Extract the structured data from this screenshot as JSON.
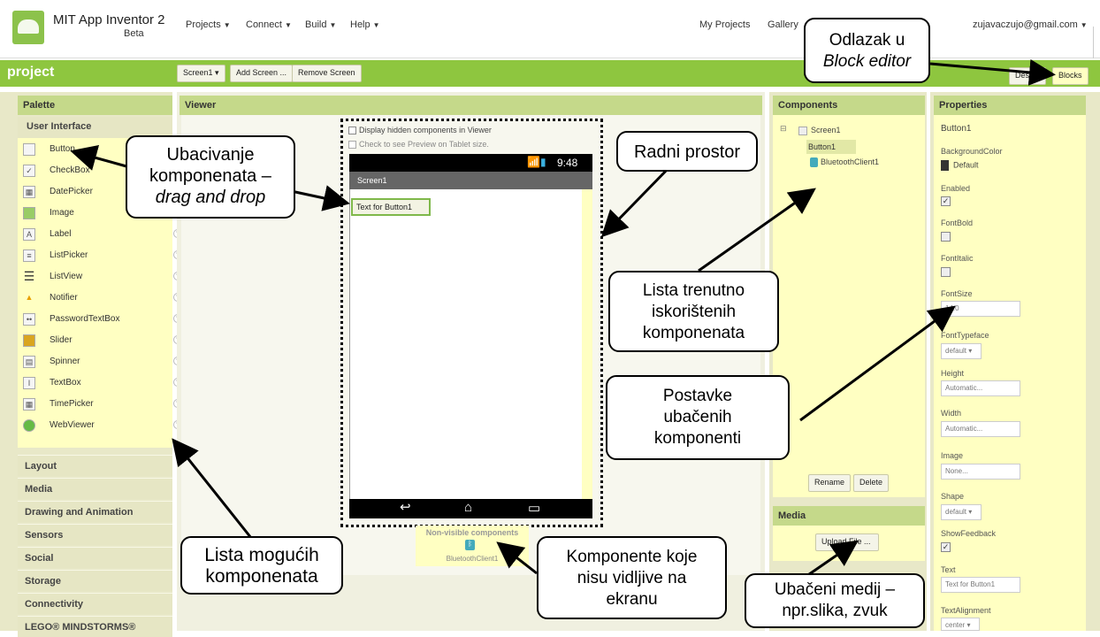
{
  "header": {
    "app_title": "MIT App Inventor 2",
    "beta": "Beta",
    "menus": [
      "Projects",
      "Connect",
      "Build",
      "Help"
    ],
    "right_links": [
      "My Projects",
      "Gallery"
    ],
    "user_email": "zujavaczujo@gmail.com"
  },
  "projectbar": {
    "project_name": "project",
    "screen_select": "Screen1",
    "add_screen": "Add Screen ...",
    "remove_screen": "Remove Screen",
    "designer": "Designer",
    "blocks": "Blocks"
  },
  "palette": {
    "title": "Palette",
    "section": "User Interface",
    "items": [
      {
        "label": "Button",
        "icon": "button-icon"
      },
      {
        "label": "CheckBox",
        "icon": "checkbox-icon"
      },
      {
        "label": "DatePicker",
        "icon": "datepicker-icon"
      },
      {
        "label": "Image",
        "icon": "image-icon"
      },
      {
        "label": "Label",
        "icon": "label-icon"
      },
      {
        "label": "ListPicker",
        "icon": "listpicker-icon"
      },
      {
        "label": "ListView",
        "icon": "listview-icon"
      },
      {
        "label": "Notifier",
        "icon": "notifier-icon"
      },
      {
        "label": "PasswordTextBox",
        "icon": "password-icon"
      },
      {
        "label": "Slider",
        "icon": "slider-icon"
      },
      {
        "label": "Spinner",
        "icon": "spinner-icon"
      },
      {
        "label": "TextBox",
        "icon": "textbox-icon"
      },
      {
        "label": "TimePicker",
        "icon": "timepicker-icon"
      },
      {
        "label": "WebViewer",
        "icon": "webviewer-icon"
      }
    ],
    "categories": [
      "Layout",
      "Media",
      "Drawing and Animation",
      "Sensors",
      "Social",
      "Storage",
      "Connectivity",
      "LEGO® MINDSTORMS®"
    ]
  },
  "viewer": {
    "title": "Viewer",
    "show_hidden": "Display hidden components in Viewer",
    "tablet_preview": "Check to see Preview on Tablet size.",
    "clock": "9:48",
    "screen_title": "Screen1",
    "button_text": "Text for Button1",
    "nonvisible_title": "Non-visible components",
    "nonvisible_item": "BluetoothClient1"
  },
  "components": {
    "title": "Components",
    "tree": [
      "Screen1",
      "Button1",
      "BluetoothClient1"
    ],
    "rename": "Rename",
    "delete": "Delete"
  },
  "media": {
    "title": "Media",
    "upload": "Upload File ..."
  },
  "properties": {
    "title": "Properties",
    "component": "Button1",
    "bg_label": "BackgroundColor",
    "bg_value": "Default",
    "enabled": "Enabled",
    "fontbold": "FontBold",
    "fontitalic": "FontItalic",
    "fontsize": "FontSize",
    "fontsize_value": "14.0",
    "fonttypeface": "FontTypeface",
    "fonttypeface_value": "default",
    "height": "Height",
    "height_value": "Automatic...",
    "width": "Width",
    "width_value": "Automatic...",
    "image": "Image",
    "image_value": "None...",
    "shape": "Shape",
    "shape_value": "default",
    "showfeedback": "ShowFeedback",
    "text": "Text",
    "text_value": "Text for Button1",
    "textalignment": "TextAlignment",
    "textalignment_value": "center"
  },
  "callouts": {
    "block_editor_1": "Odlazak u",
    "block_editor_2": "Block editor",
    "drag_1": "Ubacivanje",
    "drag_2": "komponenata –",
    "drag_3": "drag and drop",
    "workspace": "Radni prostor",
    "used_1": "Lista trenutno",
    "used_2": "iskorištenih",
    "used_3": "komponenata",
    "settings_1": "Postavke",
    "settings_2": "ubačenih",
    "settings_3": "komponenti",
    "possible_1": "Lista mogućih",
    "possible_2": "komponenata",
    "nonvisible_1": "Komponente koje",
    "nonvisible_2": "nisu vidljive na",
    "nonvisible_3": "ekranu",
    "media_1": "Ubačeni medij –",
    "media_2": "npr.slika, zvuk"
  },
  "colors": {
    "green_bar": "#8ec63f",
    "panel_header": "#c5d98a",
    "list_bg": "#ffffc2"
  }
}
